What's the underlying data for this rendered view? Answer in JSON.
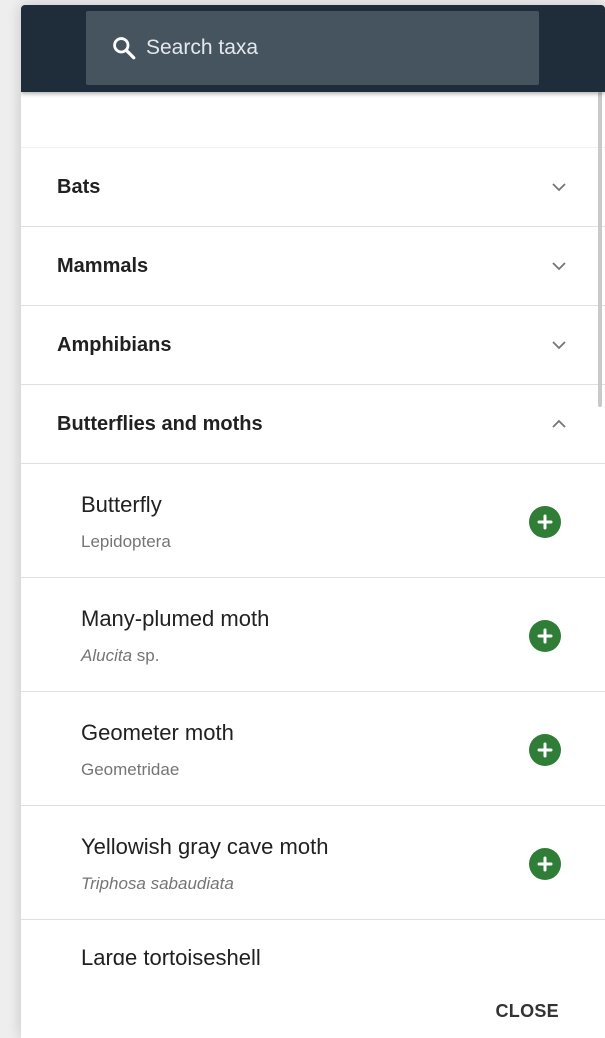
{
  "search": {
    "placeholder": "Search taxa",
    "icon": "search-icon"
  },
  "categories": [
    {
      "label": "Bats",
      "expanded": false
    },
    {
      "label": "Mammals",
      "expanded": false
    },
    {
      "label": "Amphibians",
      "expanded": false
    },
    {
      "label": "Butterflies and moths",
      "expanded": true
    }
  ],
  "items": [
    {
      "name": "Butterfly",
      "sci": "Lepidoptera",
      "sci_style": "normal"
    },
    {
      "name": "Many-plumed moth",
      "sci_italic": "Alucita",
      "sci_suffix": " sp."
    },
    {
      "name": "Geometer moth",
      "sci": "Geometridae",
      "sci_style": "normal"
    },
    {
      "name": "Yellowish gray cave moth",
      "sci_italic": "Triphosa sabaudiata"
    },
    {
      "name": "Large tortoiseshell"
    }
  ],
  "footer": {
    "close_label": "CLOSE"
  },
  "colors": {
    "topbar": "#1f2d3a",
    "searchbox": "#465460",
    "add_button": "#2f7d37"
  }
}
